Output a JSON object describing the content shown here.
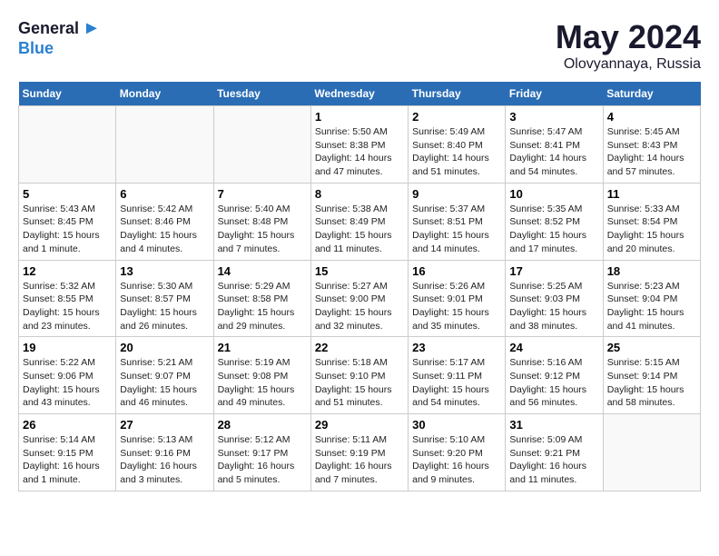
{
  "header": {
    "logo_general": "General",
    "logo_blue": "Blue",
    "month_year": "May 2024",
    "location": "Olovyannaya, Russia"
  },
  "weekdays": [
    "Sunday",
    "Monday",
    "Tuesday",
    "Wednesday",
    "Thursday",
    "Friday",
    "Saturday"
  ],
  "weeks": [
    [
      {
        "day": "",
        "info": ""
      },
      {
        "day": "",
        "info": ""
      },
      {
        "day": "",
        "info": ""
      },
      {
        "day": "1",
        "info": "Sunrise: 5:50 AM\nSunset: 8:38 PM\nDaylight: 14 hours\nand 47 minutes."
      },
      {
        "day": "2",
        "info": "Sunrise: 5:49 AM\nSunset: 8:40 PM\nDaylight: 14 hours\nand 51 minutes."
      },
      {
        "day": "3",
        "info": "Sunrise: 5:47 AM\nSunset: 8:41 PM\nDaylight: 14 hours\nand 54 minutes."
      },
      {
        "day": "4",
        "info": "Sunrise: 5:45 AM\nSunset: 8:43 PM\nDaylight: 14 hours\nand 57 minutes."
      }
    ],
    [
      {
        "day": "5",
        "info": "Sunrise: 5:43 AM\nSunset: 8:45 PM\nDaylight: 15 hours\nand 1 minute."
      },
      {
        "day": "6",
        "info": "Sunrise: 5:42 AM\nSunset: 8:46 PM\nDaylight: 15 hours\nand 4 minutes."
      },
      {
        "day": "7",
        "info": "Sunrise: 5:40 AM\nSunset: 8:48 PM\nDaylight: 15 hours\nand 7 minutes."
      },
      {
        "day": "8",
        "info": "Sunrise: 5:38 AM\nSunset: 8:49 PM\nDaylight: 15 hours\nand 11 minutes."
      },
      {
        "day": "9",
        "info": "Sunrise: 5:37 AM\nSunset: 8:51 PM\nDaylight: 15 hours\nand 14 minutes."
      },
      {
        "day": "10",
        "info": "Sunrise: 5:35 AM\nSunset: 8:52 PM\nDaylight: 15 hours\nand 17 minutes."
      },
      {
        "day": "11",
        "info": "Sunrise: 5:33 AM\nSunset: 8:54 PM\nDaylight: 15 hours\nand 20 minutes."
      }
    ],
    [
      {
        "day": "12",
        "info": "Sunrise: 5:32 AM\nSunset: 8:55 PM\nDaylight: 15 hours\nand 23 minutes."
      },
      {
        "day": "13",
        "info": "Sunrise: 5:30 AM\nSunset: 8:57 PM\nDaylight: 15 hours\nand 26 minutes."
      },
      {
        "day": "14",
        "info": "Sunrise: 5:29 AM\nSunset: 8:58 PM\nDaylight: 15 hours\nand 29 minutes."
      },
      {
        "day": "15",
        "info": "Sunrise: 5:27 AM\nSunset: 9:00 PM\nDaylight: 15 hours\nand 32 minutes."
      },
      {
        "day": "16",
        "info": "Sunrise: 5:26 AM\nSunset: 9:01 PM\nDaylight: 15 hours\nand 35 minutes."
      },
      {
        "day": "17",
        "info": "Sunrise: 5:25 AM\nSunset: 9:03 PM\nDaylight: 15 hours\nand 38 minutes."
      },
      {
        "day": "18",
        "info": "Sunrise: 5:23 AM\nSunset: 9:04 PM\nDaylight: 15 hours\nand 41 minutes."
      }
    ],
    [
      {
        "day": "19",
        "info": "Sunrise: 5:22 AM\nSunset: 9:06 PM\nDaylight: 15 hours\nand 43 minutes."
      },
      {
        "day": "20",
        "info": "Sunrise: 5:21 AM\nSunset: 9:07 PM\nDaylight: 15 hours\nand 46 minutes."
      },
      {
        "day": "21",
        "info": "Sunrise: 5:19 AM\nSunset: 9:08 PM\nDaylight: 15 hours\nand 49 minutes."
      },
      {
        "day": "22",
        "info": "Sunrise: 5:18 AM\nSunset: 9:10 PM\nDaylight: 15 hours\nand 51 minutes."
      },
      {
        "day": "23",
        "info": "Sunrise: 5:17 AM\nSunset: 9:11 PM\nDaylight: 15 hours\nand 54 minutes."
      },
      {
        "day": "24",
        "info": "Sunrise: 5:16 AM\nSunset: 9:12 PM\nDaylight: 15 hours\nand 56 minutes."
      },
      {
        "day": "25",
        "info": "Sunrise: 5:15 AM\nSunset: 9:14 PM\nDaylight: 15 hours\nand 58 minutes."
      }
    ],
    [
      {
        "day": "26",
        "info": "Sunrise: 5:14 AM\nSunset: 9:15 PM\nDaylight: 16 hours\nand 1 minute."
      },
      {
        "day": "27",
        "info": "Sunrise: 5:13 AM\nSunset: 9:16 PM\nDaylight: 16 hours\nand 3 minutes."
      },
      {
        "day": "28",
        "info": "Sunrise: 5:12 AM\nSunset: 9:17 PM\nDaylight: 16 hours\nand 5 minutes."
      },
      {
        "day": "29",
        "info": "Sunrise: 5:11 AM\nSunset: 9:19 PM\nDaylight: 16 hours\nand 7 minutes."
      },
      {
        "day": "30",
        "info": "Sunrise: 5:10 AM\nSunset: 9:20 PM\nDaylight: 16 hours\nand 9 minutes."
      },
      {
        "day": "31",
        "info": "Sunrise: 5:09 AM\nSunset: 9:21 PM\nDaylight: 16 hours\nand 11 minutes."
      },
      {
        "day": "",
        "info": ""
      }
    ]
  ]
}
